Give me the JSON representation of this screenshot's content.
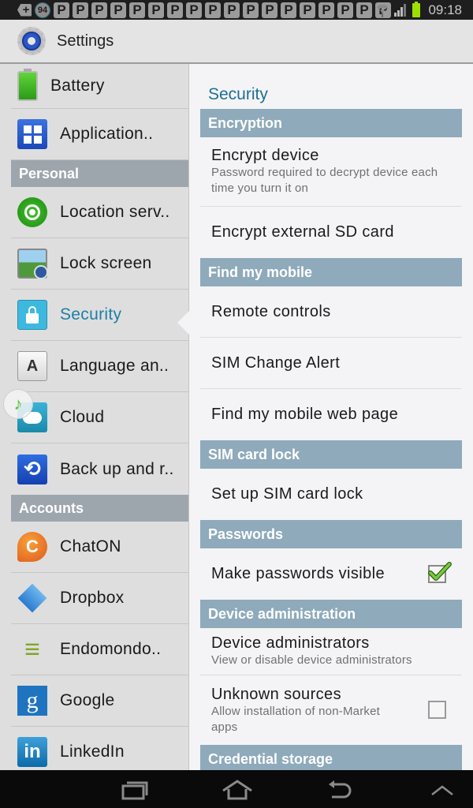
{
  "status_bar": {
    "notification_badge": "94",
    "plus_symbol": "+",
    "p_notifications": [
      "P",
      "P",
      "P",
      "P",
      "P",
      "P",
      "P",
      "P",
      "P",
      "P",
      "P",
      "P",
      "P",
      "P",
      "P",
      "P",
      "P",
      "P"
    ],
    "time": "09:18",
    "battery_color": "#9ee000"
  },
  "action_bar": {
    "title": "Settings",
    "icon": "settings-gear-icon"
  },
  "sidebar": {
    "items_top": [
      {
        "label": "Battery",
        "icon": "battery-icon"
      },
      {
        "label": "Application..",
        "icon": "application-manager-icon"
      }
    ],
    "section_personal": "Personal",
    "items_personal": [
      {
        "label": "Location serv..",
        "icon": "location-icon"
      },
      {
        "label": "Lock screen",
        "icon": "lock-screen-icon"
      },
      {
        "label": "Security",
        "icon": "security-lock-icon",
        "selected": true
      },
      {
        "label": "Language an..",
        "icon": "language-icon"
      },
      {
        "label": "Cloud",
        "icon": "cloud-icon"
      },
      {
        "label": "Back up and r..",
        "icon": "backup-icon"
      }
    ],
    "section_accounts": "Accounts",
    "items_accounts": [
      {
        "label": "ChatON",
        "icon": "chaton-icon"
      },
      {
        "label": "Dropbox",
        "icon": "dropbox-icon"
      },
      {
        "label": "Endomondo..",
        "icon": "endomondo-icon"
      },
      {
        "label": "Google",
        "icon": "google-icon"
      },
      {
        "label": "LinkedIn",
        "icon": "linkedin-icon"
      }
    ],
    "floating_music_icon": "music-note-icon",
    "accent_color": "#1d7fa6"
  },
  "detail": {
    "title": "Security",
    "sections": [
      {
        "header": "Encryption",
        "items": [
          {
            "title": "Encrypt device",
            "summary": "Password required to decrypt device each time you turn it on"
          },
          {
            "title": "Encrypt external SD card"
          }
        ]
      },
      {
        "header": "Find my mobile",
        "items": [
          {
            "title": "Remote controls"
          },
          {
            "title": "SIM Change Alert"
          },
          {
            "title": "Find my mobile web page"
          }
        ]
      },
      {
        "header": "SIM card lock",
        "items": [
          {
            "title": "Set up SIM card lock"
          }
        ]
      },
      {
        "header": "Passwords",
        "items": [
          {
            "title": "Make passwords visible",
            "checked": true
          }
        ]
      },
      {
        "header": "Device administration",
        "items": [
          {
            "title": "Device administrators",
            "summary": "View or disable device administrators"
          },
          {
            "title": "Unknown sources",
            "summary": "Allow installation of non-Market apps",
            "checked": false
          }
        ]
      },
      {
        "header": "Credential storage",
        "items": []
      }
    ],
    "header_color": "#8eaabb",
    "check_color": "#6cc23a"
  },
  "nav_bar": {
    "buttons": [
      "recent-apps",
      "home",
      "back",
      "menu-up"
    ]
  }
}
